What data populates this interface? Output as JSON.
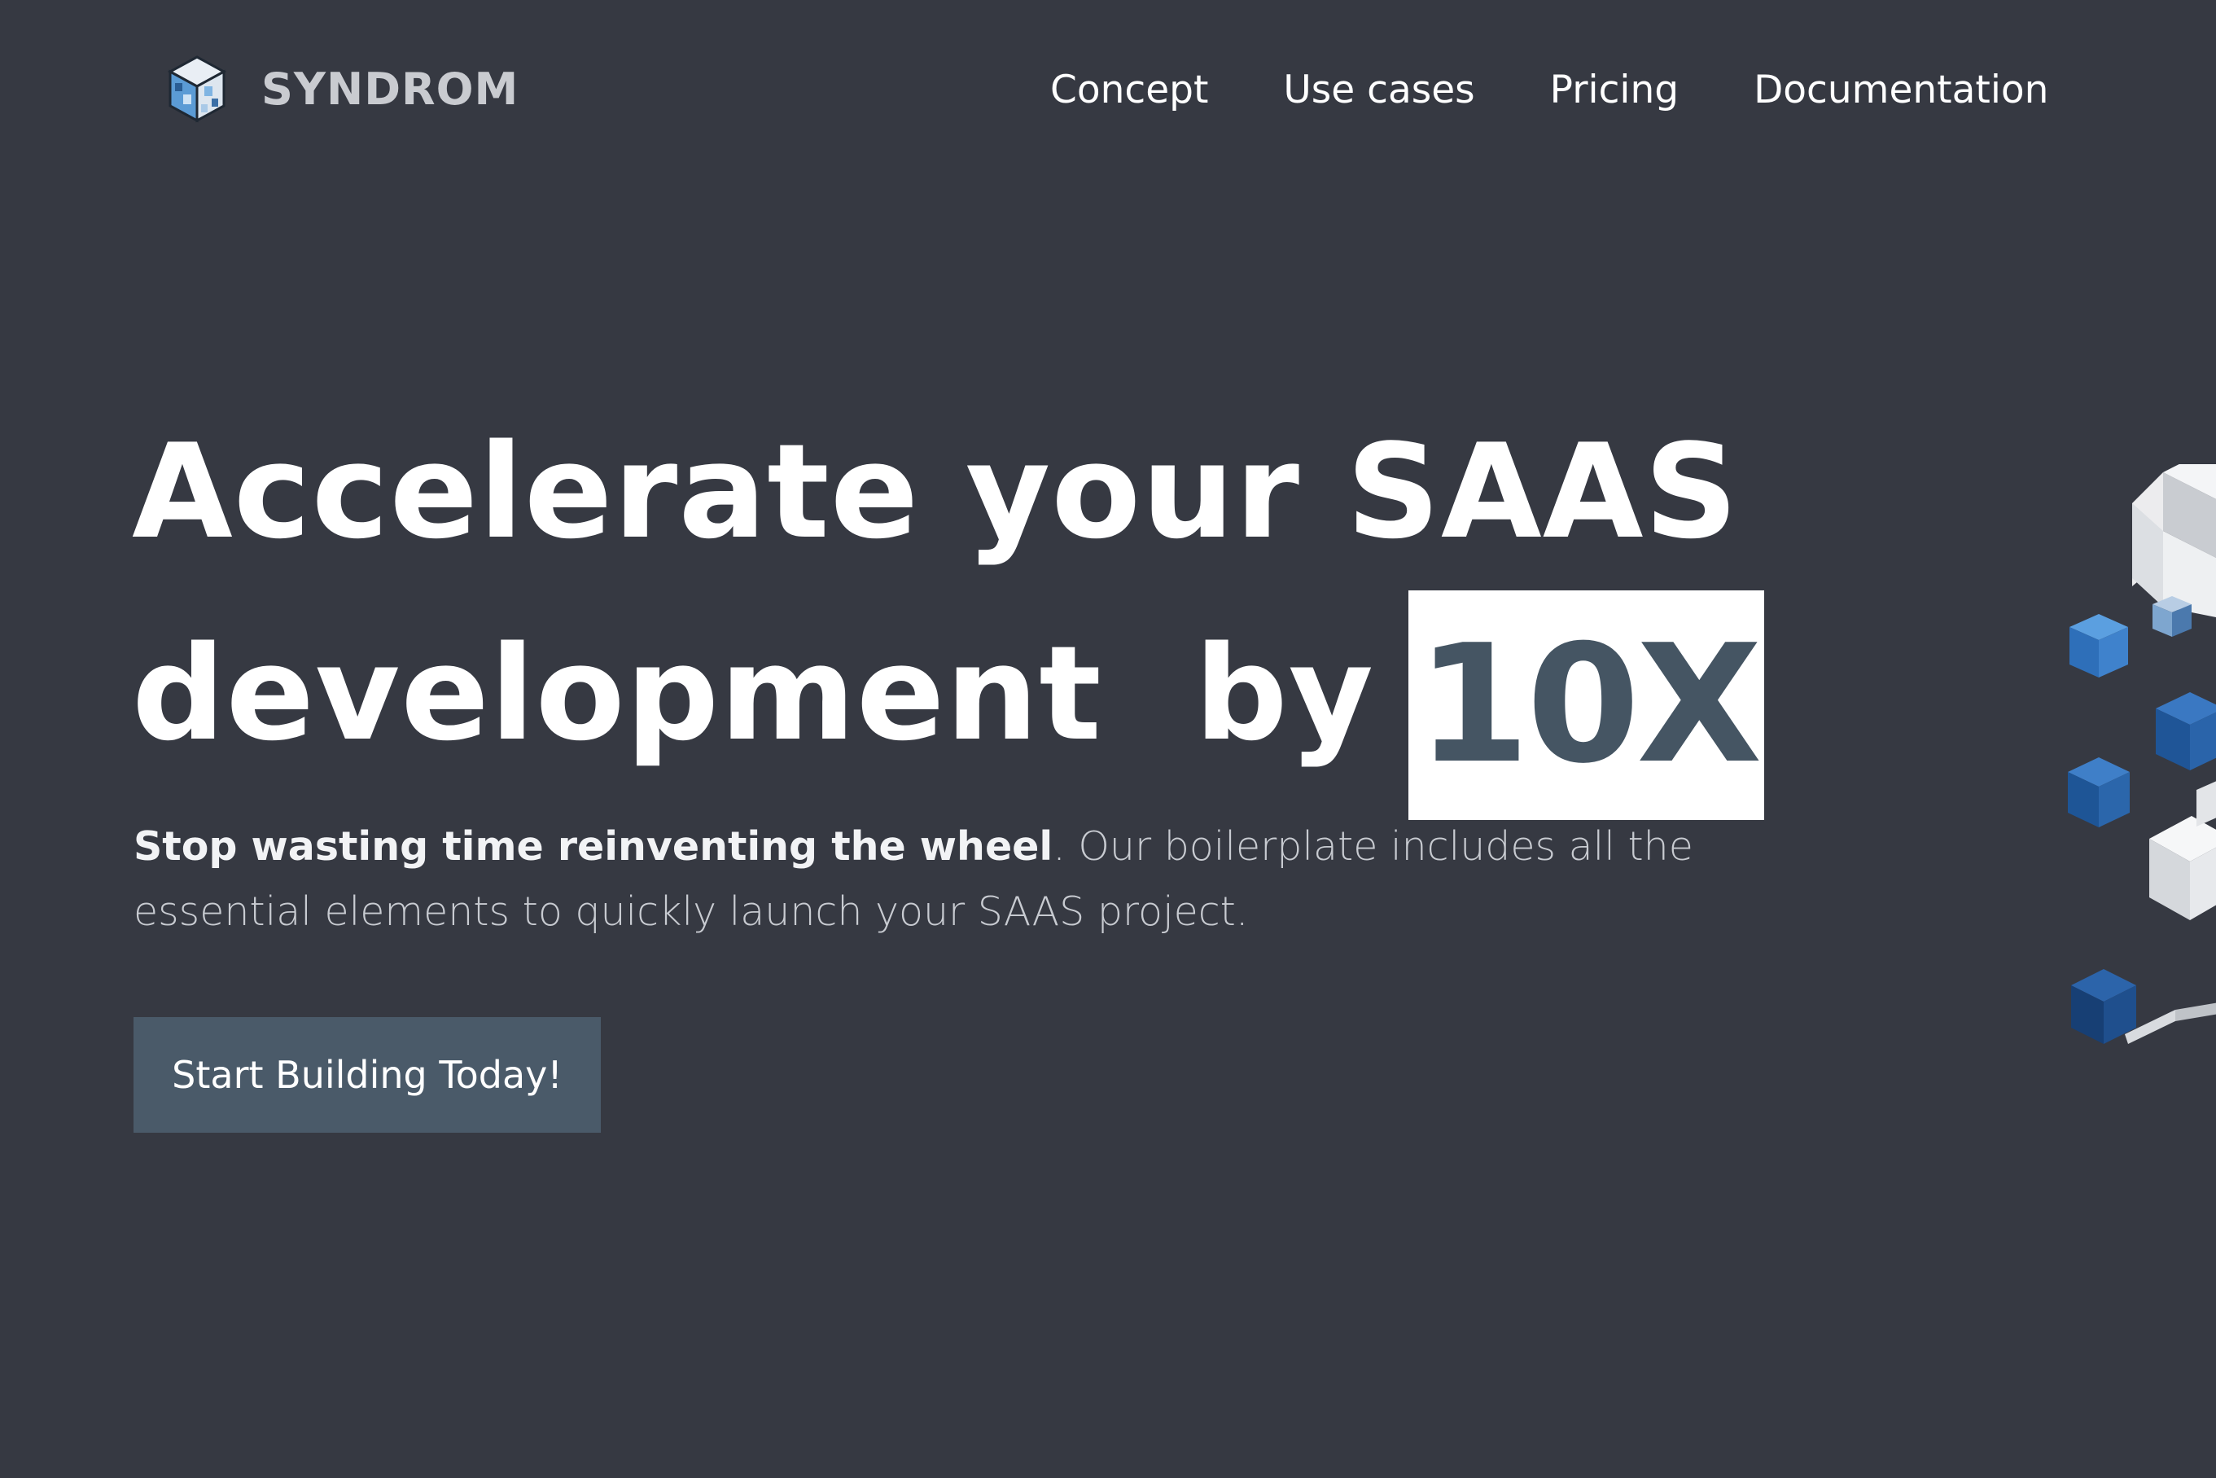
{
  "brand": {
    "name": "SYNDROM",
    "logo_icon": "cube-logo-icon"
  },
  "nav": {
    "items": [
      {
        "label": "Concept"
      },
      {
        "label": "Use cases"
      },
      {
        "label": "Pricing"
      },
      {
        "label": "Documentation"
      }
    ]
  },
  "hero": {
    "headline_line1": "Accelerate your SAAS",
    "headline_line2": "development  by",
    "highlight": "10X",
    "lead_bold": "Stop wasting time reinventing the wheel",
    "lead_rest": ". Our boilerplate includes all the essential elements to quickly launch your SAAS project.",
    "cta_label": "Start Building Today!"
  },
  "decor": {
    "icon": "isometric-cubes-icon"
  },
  "colors": {
    "background": "#363942",
    "highlight_text": "#455563",
    "cta_background": "#4a5a69",
    "accent_blue": "#2f6db5"
  }
}
